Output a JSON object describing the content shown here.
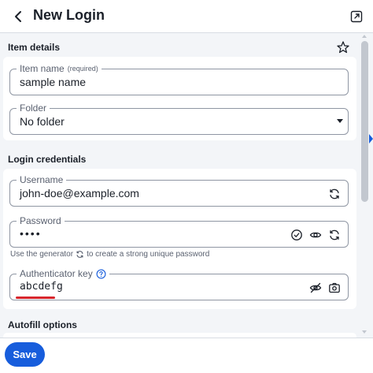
{
  "header": {
    "title": "New Login",
    "back_icon": "chevron-left-icon",
    "popout_icon": "popout-icon"
  },
  "item_details": {
    "section_title": "Item details",
    "favorite_icon": "star-icon",
    "item_name": {
      "label": "Item name",
      "required_label": "(required)",
      "value": "sample name"
    },
    "folder": {
      "label": "Folder",
      "selected": "No folder"
    }
  },
  "login_credentials": {
    "section_title": "Login credentials",
    "username": {
      "label": "Username",
      "value": "john-doe@example.com",
      "icon": "generate-icon"
    },
    "password": {
      "label": "Password",
      "value": "••••",
      "icons": [
        "check-circle-icon",
        "eye-icon",
        "generate-icon"
      ]
    },
    "generator_hint": {
      "prefix": "Use the generator",
      "suffix": "to create a strong unique password"
    },
    "authenticator": {
      "label": "Authenticator key",
      "help_icon": "help-circle-icon",
      "value": "abcdefg",
      "icons": [
        "eye-off-icon",
        "camera-icon"
      ]
    }
  },
  "autofill": {
    "section_title": "Autofill options"
  },
  "footer": {
    "save_label": "Save"
  },
  "colors": {
    "primary": "#175ddc",
    "background": "#f3f5f8",
    "card": "#ffffff",
    "text": "#1b2029",
    "muted": "#5a6170",
    "border": "#8f96a3",
    "spellcheck": "#d7262c"
  }
}
